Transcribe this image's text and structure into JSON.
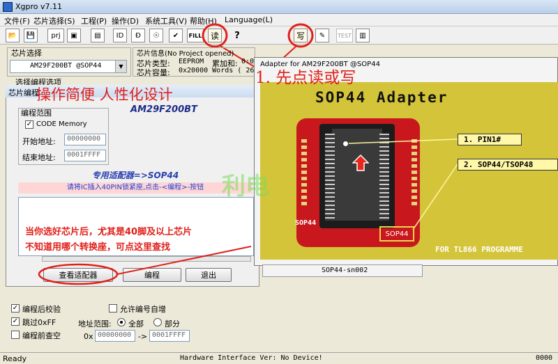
{
  "window": {
    "title": "Xgpro v7.11"
  },
  "menu": [
    "文件(F)",
    "芯片选择(S)",
    "工程(P)",
    "操作(D)",
    "系统工具(V)",
    "帮助(H)",
    "Language(L)"
  ],
  "toolbar": {
    "prj_label": "prj",
    "fill_label": "FILL",
    "read_label": "读",
    "write_label": "写",
    "test_label": "TEST",
    "help_label": "?"
  },
  "chip_select": {
    "group_label": "芯片选择",
    "selected": "AM29F200BT  @SOP44"
  },
  "chip_info": {
    "group_label": "芯片信息(No Project opened)",
    "type_label": "芯片类型:",
    "type_value": "EEPROM",
    "checksum_label": "累加和:",
    "checksum_value": "0:0",
    "capacity_label": "芯片容量:",
    "capacity_value": "0x20000 Words ( 26214"
  },
  "options_tab": "选择编程选项",
  "program_dialog": {
    "title": "芯片编程",
    "chip_name": "AM29F200BT",
    "range_group": "编程范围",
    "code_memory": "CODE Memory",
    "start_label": "开始地址:",
    "start_value": "00000000",
    "end_label": "结束地址:",
    "end_value": "0001FFFF",
    "adapter_line": "专用适配器=>SOP44",
    "instruction": "请将IC插入40PIN锁紧座,点击-<编程>-按钮",
    "view_adapter_btn": "查看适配器",
    "program_btn": "编程",
    "exit_btn": "退出"
  },
  "adapter_window": {
    "title": "Adapter for  AM29F200BT  @SOP44",
    "heading": "SOP44  Adapter",
    "callout1": "1. PIN1#",
    "callout2": "2.  SOP44/TSOP48",
    "board_label": "SOP44",
    "socket_label": "SOP44",
    "footer": "FOR TL866 PROGRAMME",
    "adapter_code": "SOP44-sn002"
  },
  "annotations": {
    "step1": "1. 先点读或写",
    "slogan": "操作简便 人性化设计",
    "hint_line1": "当你选好芯片后，尤其是40脚及以上芯片",
    "hint_line2": "不知道用哪个转换座，可点这里查找",
    "watermark": "利电"
  },
  "bottom_options": {
    "verify": "编程后校验",
    "skip_ff": "跳过0xFF",
    "blank_check": "编程前查空",
    "auto_increment": "允许编号自增",
    "addr_range_label": "地址范围:",
    "all_label": "全部",
    "part_label": "部分",
    "from_prefix": "0x",
    "from_value": "00000000",
    "arrow": "->",
    "to_value": "0001FFFF"
  },
  "status": {
    "left": "Ready",
    "center": "Hardware Interface Ver: No Device!",
    "right": "0000"
  },
  "colors": {
    "annotation_red": "#e0201a",
    "adapter_bg": "#d4c43a",
    "pcb_red": "#c8181e"
  }
}
